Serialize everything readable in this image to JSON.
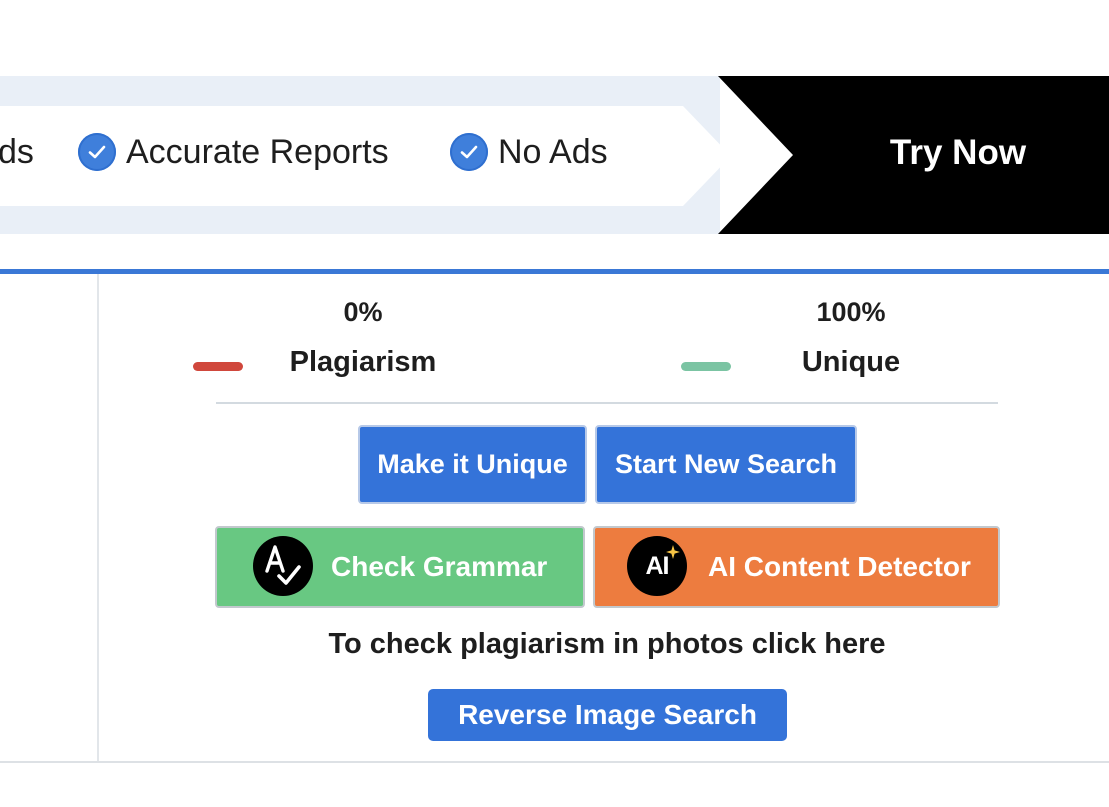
{
  "banner": {
    "features": [
      {
        "label": "ds",
        "icon": "check-circle-icon"
      },
      {
        "label": "Accurate Reports",
        "icon": "check-circle-icon"
      },
      {
        "label": "No Ads",
        "icon": "check-circle-icon"
      }
    ],
    "cta_label": "Try Now"
  },
  "results": {
    "plagiarism": {
      "percent": "0%",
      "label": "Plagiarism",
      "color": "#d0473c",
      "value": 0
    },
    "unique": {
      "percent": "100%",
      "label": "Unique",
      "color": "#7bc4a3",
      "value": 100
    }
  },
  "actions": {
    "make_unique": "Make it Unique",
    "start_new_search": "Start New Search",
    "check_grammar": "Check Grammar",
    "ai_detector": "AI Content Detector",
    "ai_icon_text": "AI"
  },
  "photo_prompt": "To check plagiarism in photos click here",
  "reverse_image_search": "Reverse Image Search",
  "colors": {
    "accent_blue": "#3473d9",
    "grammar_green": "#68c882",
    "ai_orange": "#ed7c3f",
    "banner_bg": "#e9eff7",
    "cta_bg": "#000000"
  }
}
